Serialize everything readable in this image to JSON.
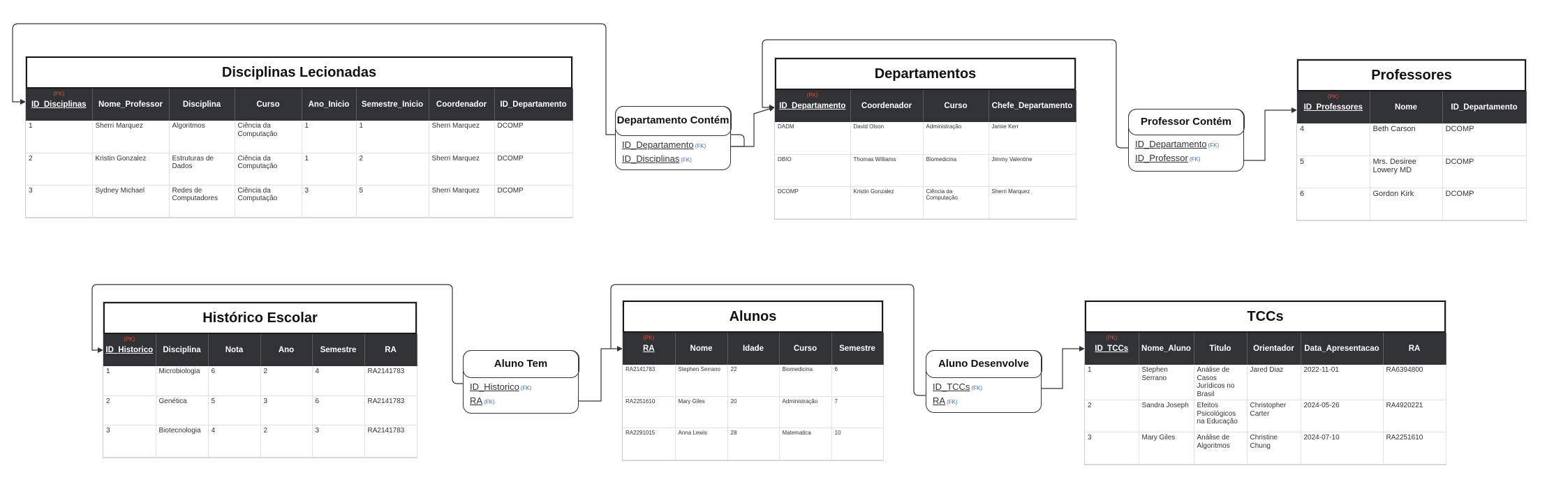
{
  "fk_marker": "(FK)",
  "pk_marker": "(PK)",
  "tables": [
    {
      "id": "disciplinas",
      "title": "Disciplinas Lecionadas",
      "columns": [
        "ID_Disciplinas",
        "Nome_Professor",
        "Disciplina",
        "Curso",
        "Ano_Inicio",
        "Semestre_Inicio",
        "Coordenador",
        "ID_Departamento"
      ],
      "pk": 0,
      "rows": [
        [
          "1",
          "Sherri Marquez",
          "Algoritmos",
          "Ciência da Computação",
          "1",
          "1",
          "Sherri Marquez",
          "DCOMP"
        ],
        [
          "2",
          "Kristin Gonzalez",
          "Estruturas de Dados",
          "Ciência da Computação",
          "1",
          "2",
          "Sherri Marquez",
          "DCOMP"
        ],
        [
          "3",
          "Sydney Michael",
          "Redes de Computadores",
          "Ciência da Computação",
          "3",
          "5",
          "Sherri Marquez",
          "DCOMP"
        ]
      ]
    },
    {
      "id": "departamentos",
      "title": "Departamentos",
      "columns": [
        "ID_Departamento",
        "Coordenador",
        "Curso",
        "Chefe_Departamento"
      ],
      "pk": 0,
      "rows": [
        [
          "DADM",
          "David Olson",
          "Administração",
          "Jamie Kerr"
        ],
        [
          "DBIO",
          "Thomas Williams",
          "Biomedicina",
          "Jimmy Valentine"
        ],
        [
          "DCOMP",
          "Kristin Gonzalez",
          "Ciência da Computação",
          "Sherri Marquez"
        ]
      ]
    },
    {
      "id": "professores",
      "title": "Professores",
      "columns": [
        "ID_Professores",
        "Nome",
        "ID_Departamento"
      ],
      "pk": 0,
      "rows": [
        [
          "4",
          "Beth Carson",
          "DCOMP"
        ],
        [
          "5",
          "Mrs. Desiree Lowery MD",
          "DCOMP"
        ],
        [
          "6",
          "Gordon Kirk",
          "DCOMP"
        ]
      ]
    },
    {
      "id": "historico",
      "title": "Histórico Escolar",
      "columns": [
        "ID_Historico",
        "Disciplina",
        "Nota",
        "Ano",
        "Semestre",
        "RA"
      ],
      "pk": 0,
      "rows": [
        [
          "1",
          "Microbiologia",
          "6",
          "2",
          "4",
          "RA2141783"
        ],
        [
          "2",
          "Genética",
          "5",
          "3",
          "6",
          "RA2141783"
        ],
        [
          "3",
          "Biotecnologia",
          "4",
          "2",
          "3",
          "RA2141783"
        ]
      ]
    },
    {
      "id": "alunos",
      "title": "Alunos",
      "columns": [
        "RA",
        "Nome",
        "Idade",
        "Curso",
        "Semestre"
      ],
      "pk": 0,
      "rows": [
        [
          "RA2141783",
          "Stephen Serrano",
          "22",
          "Biomedicina",
          "6"
        ],
        [
          "RA2251610",
          "Mary Giles",
          "20",
          "Administração",
          "7"
        ],
        [
          "RA2291015",
          "Anna Lewis",
          "28",
          "Matematica",
          "10"
        ]
      ]
    },
    {
      "id": "tccs",
      "title": "TCCs",
      "columns": [
        "ID_TCCs",
        "Nome_Aluno",
        "Titulo",
        "Orientador",
        "Data_Apresentacao",
        "RA"
      ],
      "pk": 0,
      "rows": [
        [
          "1",
          "Stephen Serrano",
          "Análise de Casos Jurídicos no Brasil",
          "Jared Diaz",
          "2022-11-01",
          "RA6394800"
        ],
        [
          "2",
          "Sandra Joseph",
          "Efeitos Psicológicos na Educação",
          "Christopher Carter",
          "2024-05-26",
          "RA4920221"
        ],
        [
          "3",
          "Mary Giles",
          "Análise de Algoritmos",
          "Christine Chung",
          "2024-07-10",
          "RA2251610"
        ]
      ]
    }
  ],
  "relations": [
    {
      "id": "dep-contem",
      "title": "Departamento Contém",
      "fields": [
        "ID_Departamento",
        "ID_Disciplinas"
      ]
    },
    {
      "id": "prof-contem",
      "title": "Professor Contém",
      "fields": [
        "ID_Departamento",
        "ID_Professor"
      ]
    },
    {
      "id": "aluno-tem",
      "title": "Aluno Tem",
      "fields": [
        "ID_Historico",
        "RA"
      ]
    },
    {
      "id": "aluno-desenvolve",
      "title": "Aluno Desenvolve",
      "fields": [
        "ID_TCCs",
        "RA"
      ]
    }
  ]
}
